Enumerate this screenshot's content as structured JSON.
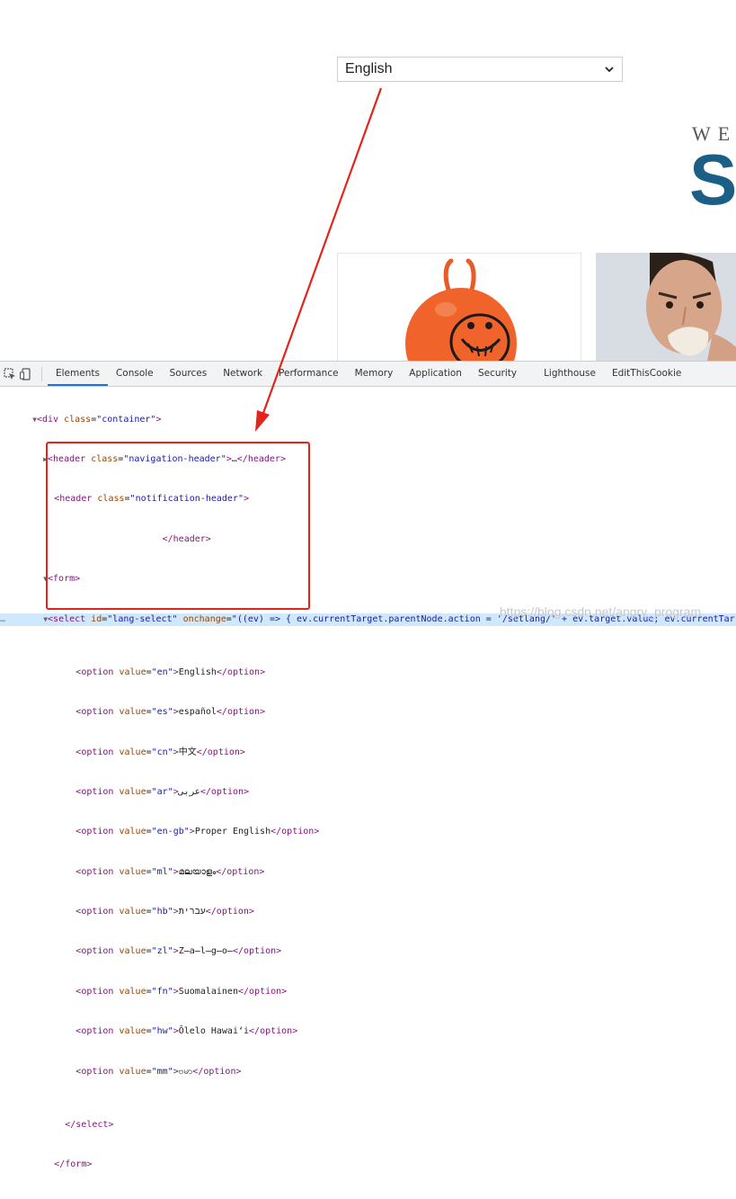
{
  "page": {
    "language_select": {
      "value": "English"
    },
    "welcome_text": "WE",
    "big_letter": "S"
  },
  "devtools": {
    "tabs": [
      "Elements",
      "Console",
      "Sources",
      "Network",
      "Performance",
      "Memory",
      "Application",
      "Security",
      "Lighthouse",
      "EditThisCookie"
    ],
    "active_tab": "Elements",
    "dom": {
      "div_open_tag": "div",
      "div_class_attr": "class",
      "div_class_val": "\"container\"",
      "header1_tag": "header",
      "header1_attr": "class",
      "header1_val": "\"navigation-header\"",
      "header1_ellipsis": "…",
      "header1_close": "</header>",
      "header2_tag": "header",
      "header2_attr": "class",
      "header2_val": "\"notification-header\"",
      "header2_close": "</header>",
      "form_tag": "form",
      "select_tag": "select",
      "select_id_attr": "id",
      "select_id_val": "\"lang-select\"",
      "select_onchange_attr": "onchange",
      "select_onchange_val": "\"((ev) => { ev.currentTarget.parentNode.action = '/setlang/' + ev.target.value; ev.currentTar",
      "options": [
        {
          "value": "\"en\"",
          "text": "English"
        },
        {
          "value": "\"es\"",
          "text": "español"
        },
        {
          "value": "\"cn\"",
          "text": "中文"
        },
        {
          "value": "\"ar\"",
          "text": "عربى"
        },
        {
          "value": "\"en-gb\"",
          "text": "Proper English"
        },
        {
          "value": "\"ml\"",
          "text": "മലയാളം"
        },
        {
          "value": "\"hb\"",
          "text": "עברית"
        },
        {
          "value": "\"zl\"",
          "text": "Z̶a̶l̶g̶o̶"
        },
        {
          "value": "\"fn\"",
          "text": "Suomalainen"
        },
        {
          "value": "\"hw\"",
          "text": "Ōlelo Hawaiʻi"
        },
        {
          "value": "\"mm\"",
          "text": "ဗမာ"
        }
      ],
      "select_close": "</select>",
      "form_close": "</form>"
    }
  },
  "watermark": "https://blog.csdn.net/angry_program",
  "colors": {
    "annotation": "#e3241b",
    "heading_blue": "#1c5f86"
  }
}
